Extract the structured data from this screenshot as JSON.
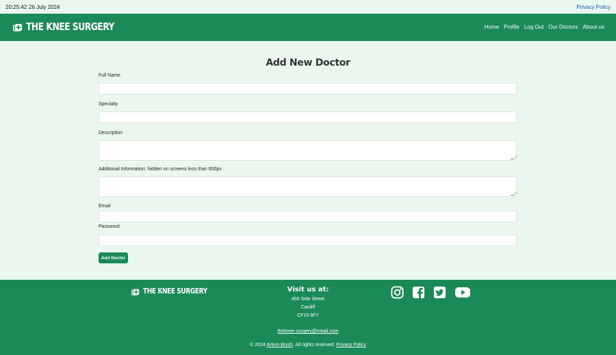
{
  "topbar": {
    "time": "20:25:42",
    "date": "26 July 2024",
    "privacy_link": "Privacy Policy"
  },
  "navbar": {
    "brand": "THE KNEE SURGERY",
    "links": [
      "Home",
      "Profile",
      "Log Out",
      "Our Doctors",
      "About us"
    ]
  },
  "page": {
    "title": "Add New Doctor"
  },
  "form": {
    "fields": [
      {
        "label": "Full Name",
        "value": ""
      },
      {
        "label": "Specialty",
        "value": ""
      },
      {
        "label": "Description",
        "value": ""
      },
      {
        "label": "Additional Information: hidden on screens less than 600px",
        "value": ""
      },
      {
        "label": "Email",
        "value": ""
      },
      {
        "label": "Password",
        "value": ""
      }
    ],
    "submit_label": "Add Doctor"
  },
  "footer": {
    "brand": "THE KNEE SURGERY",
    "visit_heading": "Visit us at:",
    "address_line1": "456 Side Street",
    "address_line2": "Cardiff",
    "address_line3": "CF19 6FY",
    "email": "theknee.surgery@email.com",
    "copyright_prefix": "© 2024 ",
    "author": "Artem Bryzh",
    "copyright_middle": ". All rights reserved. ",
    "privacy_link": "Privacy Policy",
    "social_icons": [
      "instagram-icon",
      "facebook-icon",
      "twitter-icon",
      "youtube-icon"
    ]
  },
  "colors": {
    "primary": "#1a8a56",
    "page_background": "#eaf7ef",
    "link_blue": "#1a56d6"
  }
}
